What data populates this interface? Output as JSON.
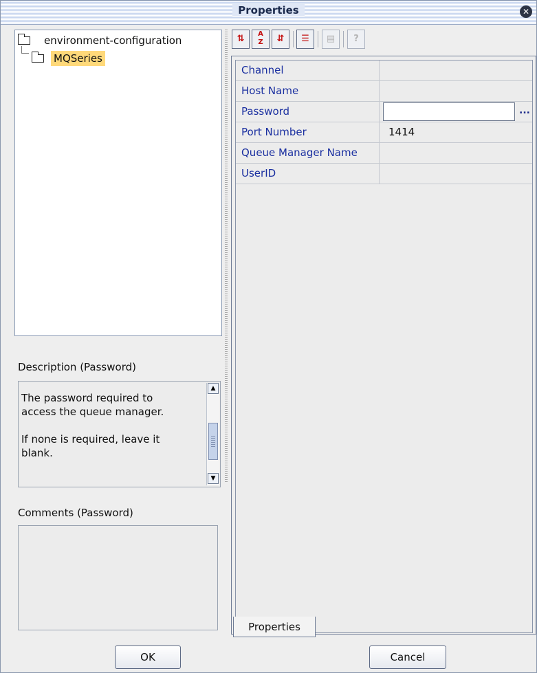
{
  "window": {
    "title": "Properties",
    "close_icon": "close-icon"
  },
  "tree": {
    "root": "environment-configuration",
    "child": "MQSeries"
  },
  "description": {
    "label": "Description (Password)",
    "text": "The password required to\naccess the queue manager.\n\nIf none is required, leave it\nblank."
  },
  "comments": {
    "label": "Comments (Password)",
    "text": ""
  },
  "toolbar": {
    "buttons": [
      "categorize-icon",
      "sort-alpha-icon",
      "sort-icon",
      "checklist-icon",
      "panel-icon",
      "help-icon"
    ]
  },
  "properties": [
    {
      "name": "Channel",
      "value": ""
    },
    {
      "name": "Host Name",
      "value": ""
    },
    {
      "name": "Password",
      "value": ""
    },
    {
      "name": "Port Number",
      "value": "1414"
    },
    {
      "name": "Queue Manager Name",
      "value": ""
    },
    {
      "name": "UserID",
      "value": ""
    }
  ],
  "ellipsis_label": "...",
  "tab_label": "Properties",
  "buttons": {
    "ok": "OK",
    "cancel": "Cancel"
  }
}
